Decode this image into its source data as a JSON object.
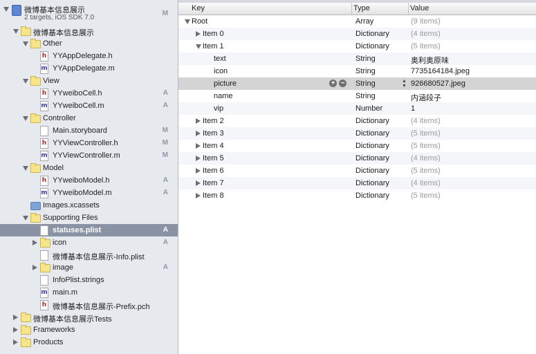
{
  "navigator": {
    "project": {
      "name": "微博基本信息展示",
      "subtitle": "2 targets, iOS SDK 7.0",
      "badge": "M"
    },
    "rows": [
      {
        "label": "微博基本信息展示",
        "kind": "folder",
        "level": 1,
        "disc": "open",
        "badge": ""
      },
      {
        "label": "Other",
        "kind": "folder",
        "level": 2,
        "disc": "open",
        "badge": ""
      },
      {
        "label": "YYAppDelegate.h",
        "kind": "h",
        "level": 3,
        "disc": "",
        "badge": ""
      },
      {
        "label": "YYAppDelegate.m",
        "kind": "m",
        "level": 3,
        "disc": "",
        "badge": ""
      },
      {
        "label": "View",
        "kind": "folder",
        "level": 2,
        "disc": "open",
        "badge": ""
      },
      {
        "label": "YYweiboCell.h",
        "kind": "h",
        "level": 3,
        "disc": "",
        "badge": "A"
      },
      {
        "label": "YYweiboCell.m",
        "kind": "m",
        "level": 3,
        "disc": "",
        "badge": "A"
      },
      {
        "label": "Controller",
        "kind": "folder",
        "level": 2,
        "disc": "open",
        "badge": ""
      },
      {
        "label": "Main.storyboard",
        "kind": "plain",
        "level": 3,
        "disc": "",
        "badge": "M"
      },
      {
        "label": "YYViewController.h",
        "kind": "h",
        "level": 3,
        "disc": "",
        "badge": "M"
      },
      {
        "label": "YYViewController.m",
        "kind": "m",
        "level": 3,
        "disc": "",
        "badge": "M"
      },
      {
        "label": "Model",
        "kind": "folder",
        "level": 2,
        "disc": "open",
        "badge": ""
      },
      {
        "label": "YYweiboModel.h",
        "kind": "h",
        "level": 3,
        "disc": "",
        "badge": "A"
      },
      {
        "label": "YYweiboModel.m",
        "kind": "m",
        "level": 3,
        "disc": "",
        "badge": "A"
      },
      {
        "label": "Images.xcassets",
        "kind": "assets",
        "level": 2,
        "disc": "",
        "badge": ""
      },
      {
        "label": "Supporting Files",
        "kind": "folder",
        "level": 2,
        "disc": "open",
        "badge": ""
      },
      {
        "label": "statuses.plist",
        "kind": "plain",
        "level": 3,
        "disc": "",
        "badge": "A",
        "selected": true
      },
      {
        "label": "icon",
        "kind": "folder",
        "level": 3,
        "disc": "closed",
        "badge": "A"
      },
      {
        "label": "微博基本信息展示-Info.plist",
        "kind": "plain",
        "level": 3,
        "disc": "",
        "badge": ""
      },
      {
        "label": "image",
        "kind": "folder",
        "level": 3,
        "disc": "closed",
        "badge": "A"
      },
      {
        "label": "InfoPlist.strings",
        "kind": "plain",
        "level": 3,
        "disc": "",
        "badge": ""
      },
      {
        "label": "main.m",
        "kind": "m",
        "level": 3,
        "disc": "",
        "badge": ""
      },
      {
        "label": "微博基本信息展示-Prefix.pch",
        "kind": "h",
        "level": 3,
        "disc": "",
        "badge": ""
      },
      {
        "label": "微博基本信息展示Tests",
        "kind": "folder",
        "level": 1,
        "disc": "closed",
        "badge": ""
      },
      {
        "label": "Frameworks",
        "kind": "folder",
        "level": 1,
        "disc": "closed",
        "badge": ""
      },
      {
        "label": "Products",
        "kind": "folder",
        "level": 1,
        "disc": "closed",
        "badge": ""
      }
    ]
  },
  "editor": {
    "columns": {
      "key": "Key",
      "type": "Type",
      "value": "Value"
    },
    "rows": [
      {
        "key": "Root",
        "type": "Array",
        "value": "(9 items)",
        "level": 0,
        "disc": "open",
        "dim": true
      },
      {
        "key": "Item 0",
        "type": "Dictionary",
        "value": "(4 items)",
        "level": 1,
        "disc": "closed",
        "dim": true
      },
      {
        "key": "Item 1",
        "type": "Dictionary",
        "value": "(5 items)",
        "level": 1,
        "disc": "open",
        "dim": true
      },
      {
        "key": "text",
        "type": "String",
        "value": "奥利奥原味",
        "level": 2,
        "disc": "",
        "dim": false
      },
      {
        "key": "icon",
        "type": "String",
        "value": "7735164184.jpeg",
        "level": 2,
        "disc": "",
        "dim": false
      },
      {
        "key": "picture",
        "type": "String",
        "value": "926680527.jpeg",
        "level": 2,
        "disc": "",
        "dim": false,
        "selected": true
      },
      {
        "key": "name",
        "type": "String",
        "value": "内涵段子",
        "level": 2,
        "disc": "",
        "dim": false
      },
      {
        "key": "vip",
        "type": "Number",
        "value": "1",
        "level": 2,
        "disc": "",
        "dim": false
      },
      {
        "key": "Item 2",
        "type": "Dictionary",
        "value": "(4 items)",
        "level": 1,
        "disc": "closed",
        "dim": true
      },
      {
        "key": "Item 3",
        "type": "Dictionary",
        "value": "(5 items)",
        "level": 1,
        "disc": "closed",
        "dim": true
      },
      {
        "key": "Item 4",
        "type": "Dictionary",
        "value": "(5 items)",
        "level": 1,
        "disc": "closed",
        "dim": true
      },
      {
        "key": "Item 5",
        "type": "Dictionary",
        "value": "(4 items)",
        "level": 1,
        "disc": "closed",
        "dim": true
      },
      {
        "key": "Item 6",
        "type": "Dictionary",
        "value": "(5 items)",
        "level": 1,
        "disc": "closed",
        "dim": true
      },
      {
        "key": "Item 7",
        "type": "Dictionary",
        "value": "(4 items)",
        "level": 1,
        "disc": "closed",
        "dim": true
      },
      {
        "key": "Item 8",
        "type": "Dictionary",
        "value": "(5 items)",
        "level": 1,
        "disc": "closed",
        "dim": true
      }
    ],
    "row_controls": {
      "add_symbol": "+",
      "remove_symbol": "−",
      "stepper_up": "▲",
      "stepper_down": "▼"
    }
  },
  "colors": {
    "selection_nav": "#8a93a4",
    "selection_editor": "#d4d4d4",
    "badge": "#8d96a6"
  }
}
